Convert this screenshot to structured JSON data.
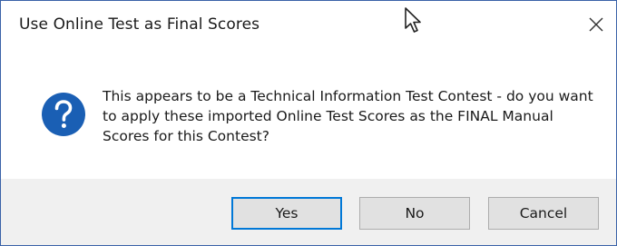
{
  "dialog": {
    "title": "Use Online Test as Final Scores",
    "message": "This appears to be a Technical Information Test Contest - do you want to apply these imported Online Test Scores as the FINAL Manual Scores for this Contest?",
    "icon": "question-icon",
    "close_icon": "close-icon"
  },
  "buttons": {
    "yes": "Yes",
    "no": "No",
    "cancel": "Cancel"
  },
  "colors": {
    "accent": "#0078d7",
    "question_icon_bg": "#1a5fb4",
    "footer_bg": "#f0f0f0",
    "button_bg": "#e1e1e1"
  }
}
